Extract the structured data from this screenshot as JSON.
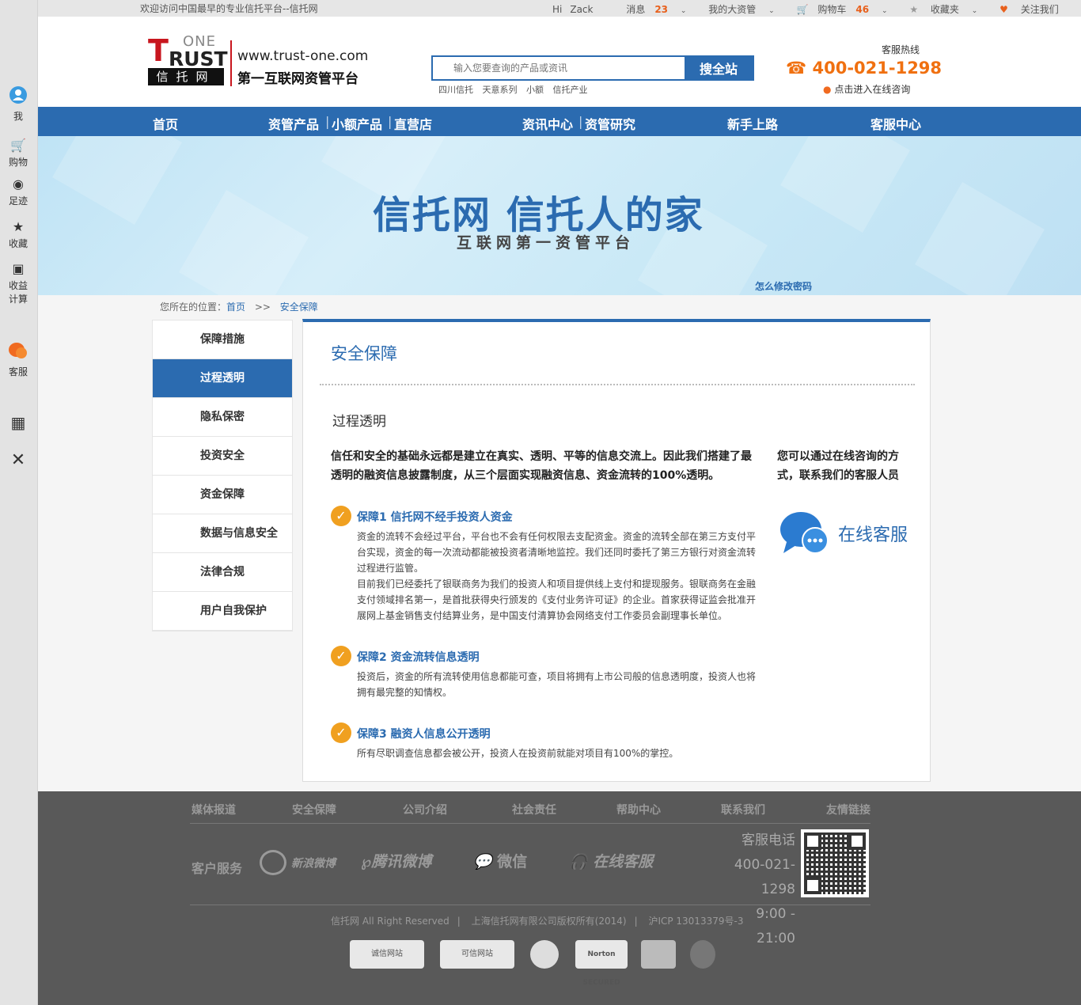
{
  "sidebar": {
    "items": [
      {
        "label": "我",
        "icon": "user-icon"
      },
      {
        "label": "购物",
        "icon": "cart-icon"
      },
      {
        "label": "足迹",
        "icon": "eye-icon"
      },
      {
        "label": "收藏",
        "icon": "star-icon"
      },
      {
        "label": "收益",
        "label2": "计算",
        "icon": "calculator-icon"
      },
      {
        "label": "客服",
        "icon": "chat-icon"
      }
    ],
    "qr_icon": "qr-code-icon",
    "close_icon": "close-icon"
  },
  "topbar": {
    "welcome": "欢迎访问中国最早的专业信托平台--信托网",
    "greeting": "Hi",
    "username": "Zack",
    "messages_label": "消息",
    "messages_count": "23",
    "assets_label": "我的大资管",
    "cart_label": "购物车",
    "cart_count": "46",
    "favorites_label": "收藏夹",
    "follow_label": "关注我们"
  },
  "header": {
    "logo_one": "ONE",
    "logo_t": "T",
    "logo_rust": "RUST",
    "logo_cn": "信托网",
    "site_url": "www.trust-one.com",
    "site_slogan": "第一互联网资管平台",
    "search_placeholder": "输入您要查询的产品或资讯",
    "search_button": "搜全站",
    "hot_words": [
      "四川信托",
      "天意系列",
      "小额",
      "信托产业"
    ],
    "hotline_label": "客服热线",
    "hotline": "400-021-1298",
    "online_consult": "点击进入在线咨询"
  },
  "nav": [
    "首页",
    "资管产品",
    "小额产品",
    "直营店",
    "资讯中心",
    "资管研究",
    "新手上路",
    "客服中心"
  ],
  "banner": {
    "title": "信托网 信托人的家",
    "subtitle": "互联网第一资管平台",
    "link": "怎么修改密码"
  },
  "breadcrumb": {
    "prefix": "您所在的位置：",
    "home": "首页",
    "sep": ">>",
    "current": "安全保障"
  },
  "leftnav": [
    "保障措施",
    "过程透明",
    "隐私保密",
    "投资安全",
    "资金保障",
    "数据与信息安全",
    "法律合规",
    "用户自我保护"
  ],
  "content": {
    "title": "安全保障",
    "subtitle": "过程透明",
    "intro": "信任和安全的基础永远都是建立在真实、透明、平等的信息交流上。因此我们搭建了最透明的融资信息披露制度，从三个层面实现融资信息、资金流转的100%透明。",
    "aside": "您可以通过在线咨询的方式，联系我们的客服人员",
    "online_service": "在线客服",
    "guarantees": [
      {
        "title": "保障1  信托网不经手投资人资金",
        "body": "资金的流转不会经过平台，平台也不会有任何权限去支配资金。资金的流转全部在第三方支付平台实现，资金的每一次流动都能被投资者清晰地监控。我们还同时委托了第三方银行对资金流转过程进行监管。",
        "body2": "目前我们已经委托了银联商务为我们的投资人和项目提供线上支付和提现服务。银联商务在金融支付领域排名第一，是首批获得央行颁发的《支付业务许可证》的企业。首家获得证监会批准开展网上基金销售支付结算业务，是中国支付清算协会网络支付工作委员会副理事长单位。"
      },
      {
        "title": "保障2  资金流转信息透明",
        "body": "投资后，资金的所有流转使用信息都能可查，项目将拥有上市公司般的信息透明度，投资人也将拥有最完整的知情权。",
        "body2": ""
      },
      {
        "title": "保障3  融资人信息公开透明",
        "body": "所有尽职调查信息都会被公开，投资人在投资前就能对项目有100%的掌控。",
        "body2": ""
      }
    ]
  },
  "footer": {
    "links": [
      "媒体报道",
      "安全保障",
      "公司介绍",
      "社会责任",
      "帮助中心",
      "联系我们",
      "友情链接"
    ],
    "service_label": "客户服务",
    "channels": [
      "新浪微博",
      "腾讯微博",
      "微信",
      "在线客服"
    ],
    "contact_label": "客服电话",
    "contact_phone": "400-021-1298",
    "contact_hours": "9:00 - 21:00",
    "copyright": [
      "信托网 All Right Reserved",
      "上海信托网有限公司版权所有(2014)",
      "沪ICP 13013379号-3"
    ],
    "badges": [
      "诚信网站",
      "可信网站",
      "Norton SECURED"
    ]
  }
}
